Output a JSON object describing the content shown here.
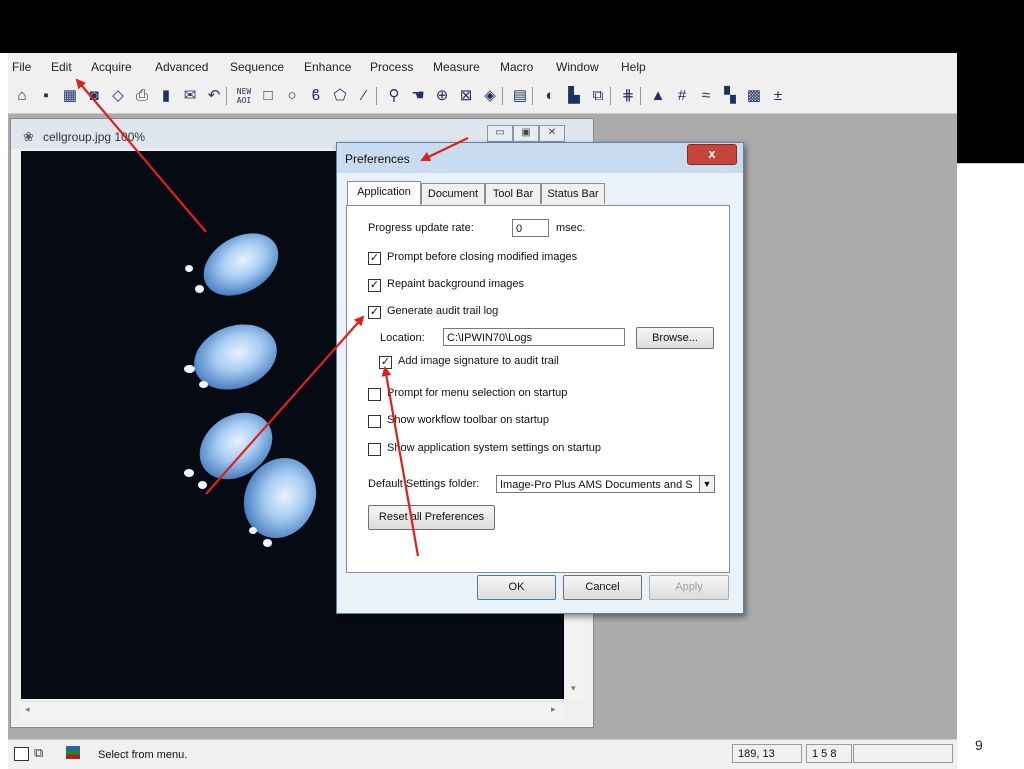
{
  "menu": [
    "File",
    "Edit",
    "Acquire",
    "Advanced",
    "Sequence",
    "Enhance",
    "Process",
    "Measure",
    "Macro",
    "Window",
    "Help"
  ],
  "toolbar_icons": [
    "open-icon",
    "save-icon",
    "grid-icon",
    "camera-icon",
    "scan-icon",
    "print-icon",
    "book-icon",
    "mail-icon",
    "undo-icon",
    "new-aoi-icon",
    "rectangle-icon",
    "ellipse-icon",
    "freehand-icon",
    "polygon-icon",
    "wand-icon",
    "zoom-icon",
    "hand-icon",
    "zoom-region-icon",
    "cross-icon",
    "palette-icon",
    "stack-icon",
    "contrast-icon",
    "histogram-icon",
    "copy-icon",
    "grid2-icon",
    "mountain-icon",
    "hash-icon",
    "flat-icon",
    "blocks-icon",
    "matrix-icon",
    "math-icon"
  ],
  "new_aoi_label": "NEW\nAOI",
  "image_window": {
    "title": "cellgroup.jpg 100%"
  },
  "dialog": {
    "title": "Preferences",
    "close": "x",
    "tabs": [
      "Application",
      "Document",
      "Tool Bar",
      "Status Bar"
    ],
    "progress_label": "Progress update rate:",
    "progress_value": "0",
    "progress_unit": "msec.",
    "options": [
      {
        "label": "Prompt before closing modified images",
        "checked": true
      },
      {
        "label": "Repaint background images",
        "checked": true
      },
      {
        "label": "Generate audit trail log",
        "checked": true
      }
    ],
    "location_label": "Location:",
    "location_value": "C:\\IPWIN70\\Logs",
    "browse": "Browse...",
    "signature": {
      "label": "Add image signature to audit trail",
      "checked": true
    },
    "startup_options": [
      {
        "label": "Prompt for menu selection on startup",
        "checked": false
      },
      {
        "label": "Show workflow toolbar on startup",
        "checked": false
      },
      {
        "label": "Show application system settings on startup",
        "checked": false
      }
    ],
    "default_folder_label": "Default Settings folder:",
    "default_folder_value": "Image-Pro Plus AMS Documents and S",
    "reset": "Reset all Preferences",
    "ok": "OK",
    "cancel": "Cancel",
    "apply": "Apply"
  },
  "statusbar": {
    "message": "Select from menu.",
    "coords": "189, 13",
    "extra": "1 5 8"
  },
  "page_number": "9",
  "colors": {
    "arrow": "#e0201a",
    "titlebar": "#c9dbef",
    "close": "#c6453a"
  }
}
